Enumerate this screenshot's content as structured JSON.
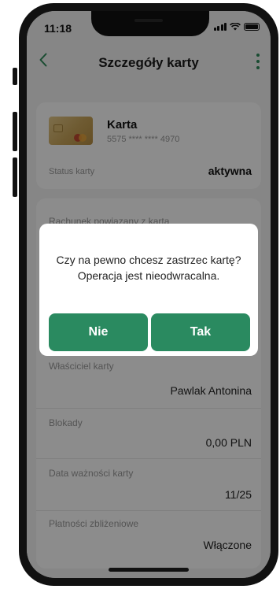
{
  "status_bar": {
    "time": "11:18"
  },
  "header": {
    "title": "Szczegóły karty",
    "back_icon": "chevron-left-icon",
    "menu_icon": "more-vertical-icon"
  },
  "card": {
    "name": "Karta",
    "number": "5575 **** **** 4970",
    "status_label": "Status karty",
    "status_value": "aktywna"
  },
  "details": {
    "linked_account_label": "Rachunek powiązany z kartą",
    "owner_label": "Właściciel karty",
    "owner_value": "Pawlak Antonina",
    "blocks_label": "Blokady",
    "blocks_value": "0,00 PLN",
    "expiry_label": "Data ważności karty",
    "expiry_value": "11/25",
    "contactless_label": "Płatności zbliżeniowe",
    "contactless_value": "Włączone"
  },
  "dialog": {
    "line1": "Czy na pewno chcesz zastrzec kartę?",
    "line2": "Operacja jest nieodwracalna.",
    "no_label": "Nie",
    "yes_label": "Tak"
  },
  "colors": {
    "accent": "#2a8a60",
    "overlay": "rgba(0,0,0,0.45)"
  }
}
